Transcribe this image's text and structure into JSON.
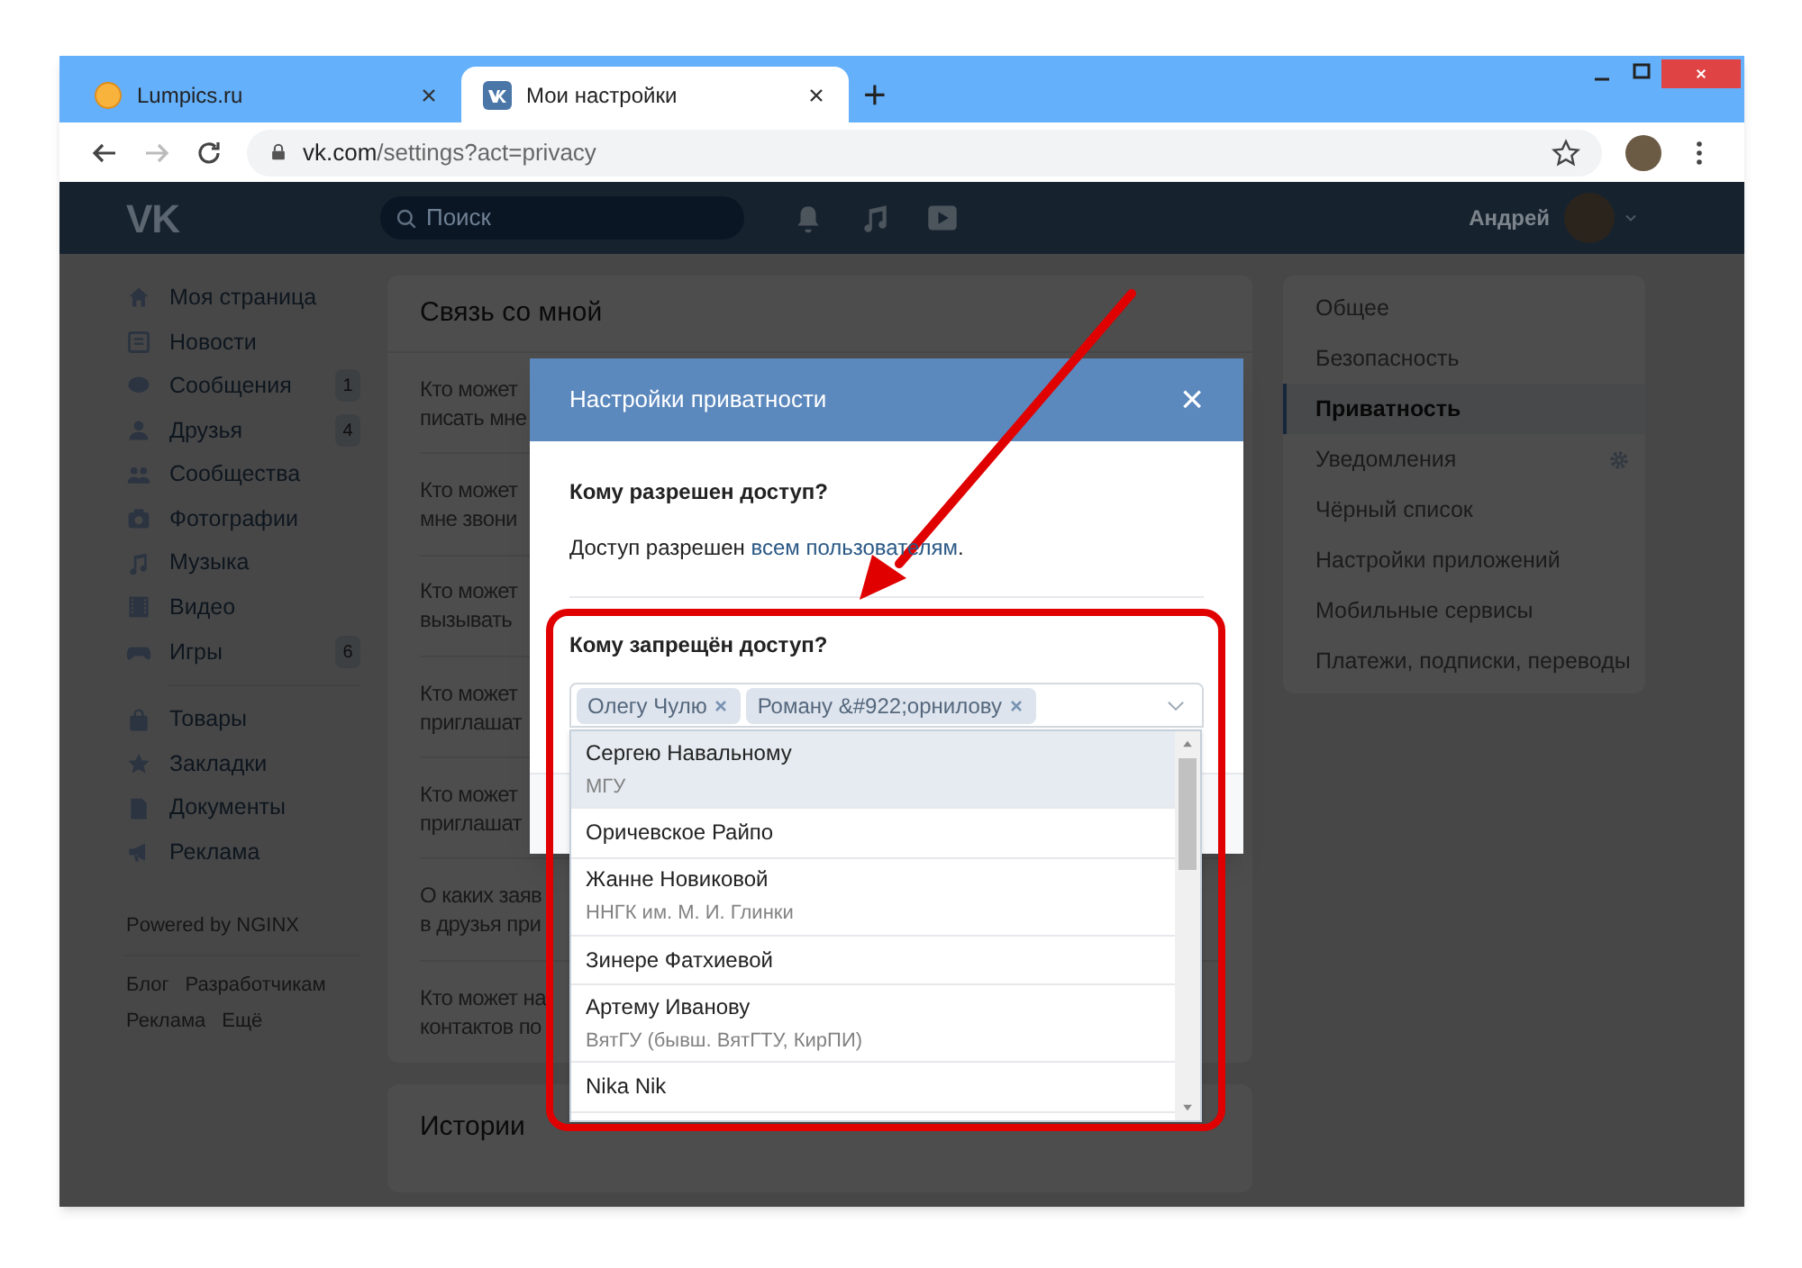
{
  "browser": {
    "tabs": [
      {
        "title": "Lumpics.ru",
        "selected": false
      },
      {
        "title": "Мои настройки",
        "selected": true
      }
    ],
    "new_tab": "+",
    "url_host": "vk.com",
    "url_path": "/settings?act=privacy",
    "forward_disabled": true
  },
  "vk_header": {
    "logo": "VK",
    "search_placeholder": "Поиск",
    "user_name": "Андрей"
  },
  "sidebar": {
    "main_items": [
      {
        "label": "Моя страница"
      },
      {
        "label": "Новости"
      },
      {
        "label": "Сообщения",
        "badge": "1"
      },
      {
        "label": "Друзья",
        "badge": "4"
      },
      {
        "label": "Сообщества"
      },
      {
        "label": "Фотографии"
      },
      {
        "label": "Музыка"
      },
      {
        "label": "Видео"
      },
      {
        "label": "Игры",
        "badge": "6"
      }
    ],
    "extra_items": [
      {
        "label": "Товары"
      },
      {
        "label": "Закладки"
      },
      {
        "label": "Документы"
      },
      {
        "label": "Реклама"
      }
    ],
    "note": "Powered by NGINX",
    "footer_links": [
      "Блог",
      "Разработчикам",
      "Реклама",
      "Ещё"
    ]
  },
  "settings_card": {
    "title": "Связь со мной",
    "rows": [
      [
        "Кто может",
        "писать мне"
      ],
      [
        "Кто может",
        "мне звони"
      ],
      [
        "Кто может",
        "вызывать"
      ],
      [
        "Кто может",
        "приглашат"
      ],
      [
        "Кто может",
        "приглашат"
      ],
      [
        "О каких заяв",
        "в друзья при"
      ],
      [
        "Кто может на",
        "контактов по"
      ]
    ]
  },
  "stories_card": {
    "title": "Истории"
  },
  "settings_menu": [
    {
      "label": "Общее",
      "selected": false,
      "gear": false
    },
    {
      "label": "Безопасность",
      "selected": false,
      "gear": false
    },
    {
      "label": "Приватность",
      "selected": true,
      "gear": false
    },
    {
      "label": "Уведомления",
      "selected": false,
      "gear": true
    },
    {
      "label": "Чёрный список",
      "selected": false,
      "gear": false
    },
    {
      "label": "Настройки приложений",
      "selected": false,
      "gear": false
    },
    {
      "label": "Мобильные сервисы",
      "selected": false,
      "gear": false
    },
    {
      "label": "Платежи, подписки, переводы",
      "selected": false,
      "gear": false
    }
  ],
  "modal": {
    "title": "Настройки приватности",
    "close": "×",
    "allowed_heading": "Кому разрешен доступ?",
    "allowed_text": "Доступ разрешен",
    "allowed_link": "всем пользователям",
    "allowed_end": ".",
    "denied_heading": "Кому запрещён доступ?",
    "tokens": [
      "Олегу Чулю",
      "Роману &#922;орнилову"
    ],
    "options": [
      {
        "name": "Сергею Навальному",
        "detail": "МГУ",
        "selected": true
      },
      {
        "name": "Оричевское Райпо",
        "selected": false
      },
      {
        "name": "Жанне Новиковой",
        "detail": "ННГК им. М. И. Глинки",
        "selected": false
      },
      {
        "name": "Зинере Фатхиевой",
        "selected": false
      },
      {
        "name": "Артему Иванову",
        "detail": "ВятГУ (бывш. ВятГТУ, КирПИ)",
        "selected": false
      },
      {
        "name": "Nika Nik",
        "selected": false
      }
    ]
  }
}
